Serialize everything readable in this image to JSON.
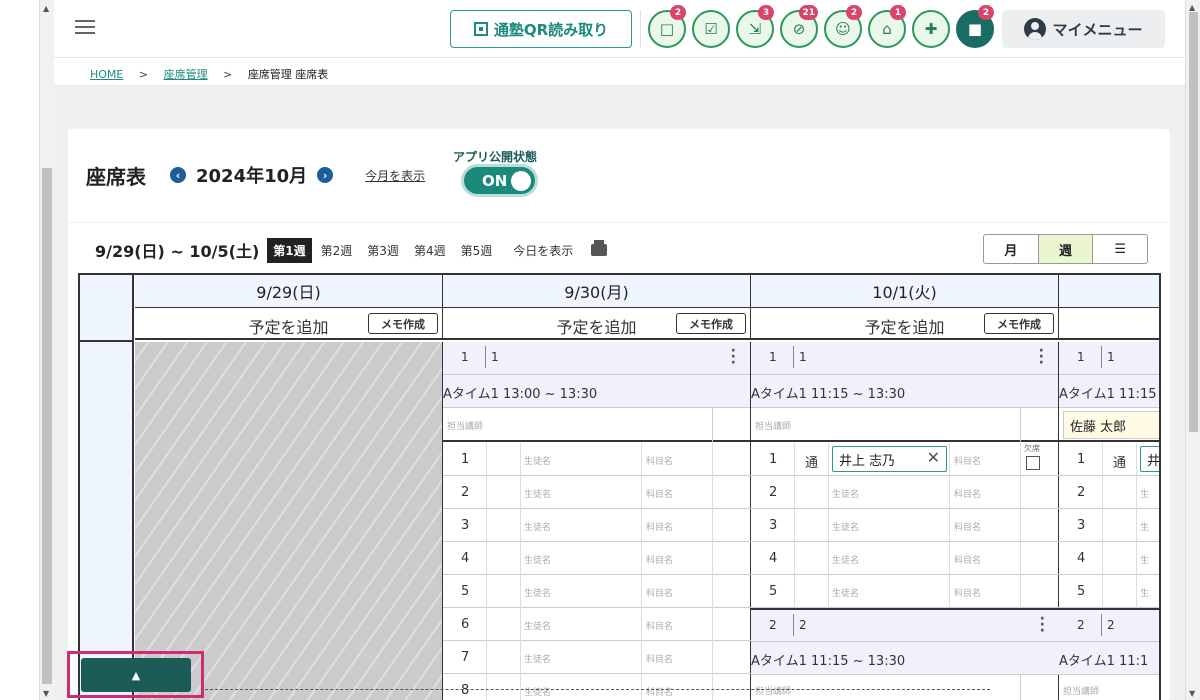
{
  "header": {
    "qr_label": "通塾QR読み取り",
    "icons": [
      {
        "name": "message-icon",
        "badge": "2"
      },
      {
        "name": "checklist-icon",
        "badge": ""
      },
      {
        "name": "merge-icon",
        "badge": "3"
      },
      {
        "name": "blocked-icon",
        "badge": "21"
      },
      {
        "name": "group-icon",
        "badge": "2"
      },
      {
        "name": "bank-icon",
        "badge": "1"
      },
      {
        "name": "gift-icon",
        "badge": ""
      },
      {
        "name": "chat-icon",
        "badge": "2"
      }
    ],
    "my_menu": "マイメニュー"
  },
  "breadcrumb": {
    "home": "HOME",
    "sep": ">",
    "seat_mgmt": "座席管理",
    "current": "座席管理 座席表"
  },
  "page": {
    "title": "座席表",
    "month": "2024年10月",
    "this_month": "今月を表示",
    "app_state_label": "アプリ公開状態",
    "toggle": "ON"
  },
  "week_bar": {
    "range": "9/29(日) ~ 10/5(土)",
    "weeks": [
      "第1週",
      "第2週",
      "第3週",
      "第4週",
      "第5週"
    ],
    "today": "今日を表示",
    "views": [
      "月",
      "週",
      "☰"
    ]
  },
  "grid": {
    "days": [
      "9/29(日)",
      "9/30(月)",
      "10/1(火)"
    ],
    "add_schedule": "予定を追加",
    "memo": "メモ作成",
    "block1_num": "1",
    "block1_seat": "1",
    "block2_num": "2",
    "block2_seat": "2",
    "time_mon": "Aタイム1 13:00 ~ 13:30",
    "time_tue": "Aタイム1 11:15 ~ 13:30",
    "time_wed": "Aタイム1 11:15",
    "time_tue2": "Aタイム1 11:15 ~ 13:30",
    "time_wed2": "Aタイム1 11:1",
    "teacher_label": "担当講師",
    "teacher_name": "佐藤 太郎",
    "student_label": "生徒名",
    "subject_label": "科目名",
    "attend": "通",
    "student_name": "井上 志乃",
    "absent": "欠席",
    "row_numbers": [
      "1",
      "2",
      "3",
      "4",
      "5",
      "6",
      "7",
      "8"
    ],
    "row_numbers_tue": [
      "1",
      "2",
      "3",
      "4",
      "5"
    ]
  },
  "scroll_up": "▲"
}
